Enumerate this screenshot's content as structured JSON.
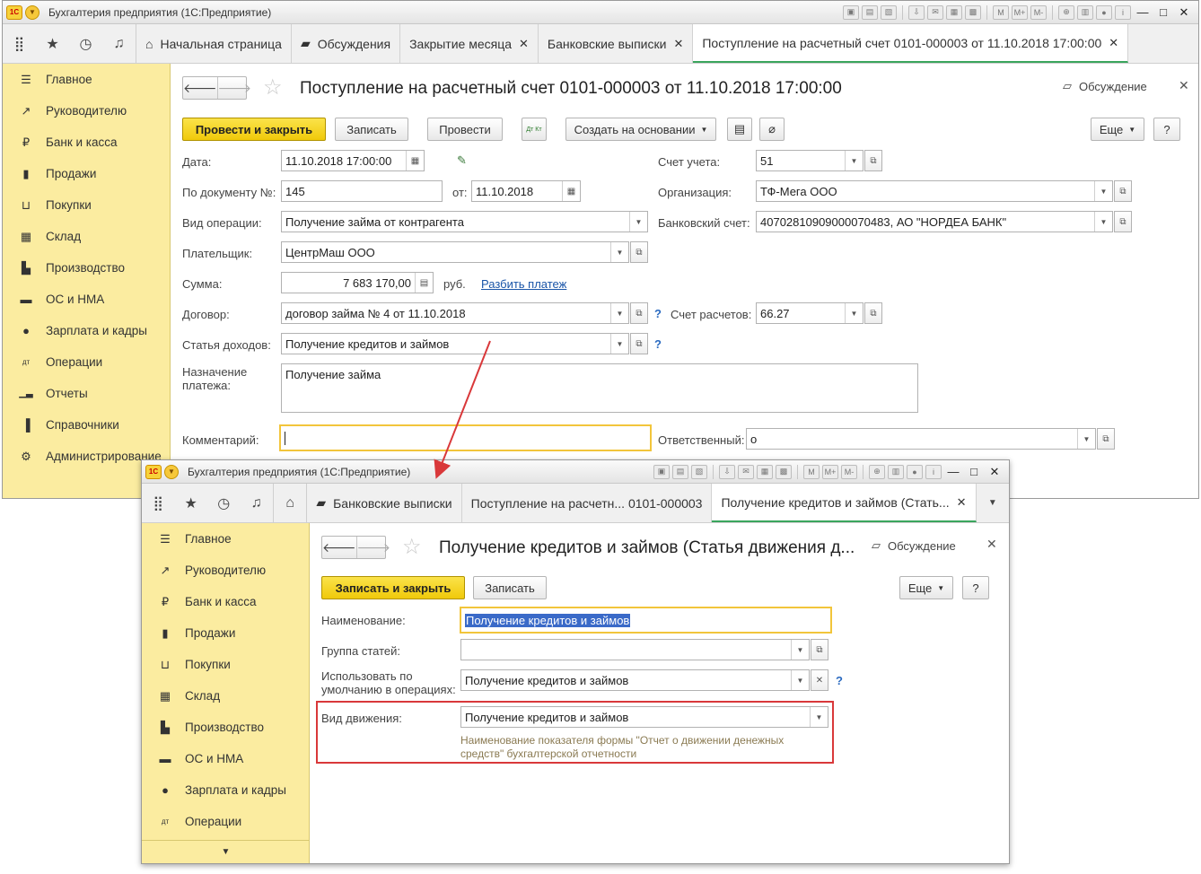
{
  "app_title": "Бухгалтерия предприятия  (1С:Предприятие)",
  "logo_text": "1С",
  "sidebar_items": [
    {
      "label": "Главное",
      "icon": "menu-icon",
      "glyph": "☰"
    },
    {
      "label": "Руководителю",
      "icon": "trend-icon",
      "glyph": "↗"
    },
    {
      "label": "Банк и касса",
      "icon": "ruble-icon",
      "glyph": "₽"
    },
    {
      "label": "Продажи",
      "icon": "bag-icon",
      "glyph": "▮"
    },
    {
      "label": "Покупки",
      "icon": "cart-icon",
      "glyph": "⊔"
    },
    {
      "label": "Склад",
      "icon": "warehouse-icon",
      "glyph": "▦"
    },
    {
      "label": "Производство",
      "icon": "factory-icon",
      "glyph": "▙"
    },
    {
      "label": "ОС и НМА",
      "icon": "truck-icon",
      "glyph": "▬"
    },
    {
      "label": "Зарплата и кадры",
      "icon": "person-icon",
      "glyph": "●"
    },
    {
      "label": "Операции",
      "icon": "dtkt-icon",
      "glyph": "дт"
    },
    {
      "label": "Отчеты",
      "icon": "barchart-icon",
      "glyph": "▁▃"
    },
    {
      "label": "Справочники",
      "icon": "book-icon",
      "glyph": "▐"
    },
    {
      "label": "Администрирование",
      "icon": "gear-icon",
      "glyph": "⚙"
    }
  ],
  "w1": {
    "tabs": [
      {
        "label": "Начальная страница",
        "icon": "home-icon"
      },
      {
        "label": "Обсуждения",
        "icon": "chat-icon"
      },
      {
        "label": "Закрытие месяца",
        "closable": true
      },
      {
        "label": "Банковские выписки",
        "closable": true
      },
      {
        "label": "Поступление на расчетный счет 0101-000003 от 11.10.2018 17:00:00",
        "closable": true,
        "active": true
      }
    ],
    "form_title": "Поступление на расчетный счет 0101-000003 от 11.10.2018 17:00:00",
    "discuss_label": "Обсуждение",
    "buttons": {
      "post_close": "Провести и закрыть",
      "save": "Записать",
      "post": "Провести",
      "dtkt": "Дт Кт",
      "create_based": "Создать на основании",
      "more": "Еще",
      "help": "?"
    },
    "labels": {
      "date": "Дата:",
      "doc_no": "По документу №:",
      "from": "от:",
      "op_type": "Вид операции:",
      "payer": "Плательщик:",
      "amount": "Сумма:",
      "currency": "руб.",
      "split": "Разбить платеж",
      "contract": "Договор:",
      "income_item": "Статья доходов:",
      "purpose": "Назначение платежа:",
      "comment": "Комментарий:",
      "account": "Счет учета:",
      "org": "Организация:",
      "bank_acc": "Банковский счет:",
      "settle_acc": "Счет расчетов:",
      "responsible": "Ответственный:",
      "question": "?"
    },
    "values": {
      "date": "11.10.2018 17:00:00",
      "doc_no": "145",
      "doc_date": "11.10.2018",
      "op_type": "Получение займа от контрагента",
      "payer": "ЦентрМаш ООО",
      "amount": "7 683 170,00",
      "contract": "договор займа № 4 от 11.10.2018",
      "income_item": "Получение кредитов и займов",
      "purpose": "Получение займа",
      "comment": "",
      "account": "51",
      "org": "ТФ-Мега ООО",
      "bank_acc": "40702810909000070483, АО \"НОРДЕА БАНК\"",
      "settle_acc": "66.27",
      "responsible": "о"
    }
  },
  "w2": {
    "tabs": [
      {
        "label": "Банковские выписки",
        "icon": "chat-icon",
        "closable": true
      },
      {
        "label": "Поступление на расчетн...  0101-000003",
        "closable": true
      },
      {
        "label": "Получение кредитов и займов (Стать...",
        "closable": true,
        "active": true
      }
    ],
    "form_title": "Получение кредитов и займов (Статья движения д...",
    "discuss_label": "Обсуждение",
    "buttons": {
      "save_close": "Записать и закрыть",
      "save": "Записать",
      "more": "Еще",
      "help": "?"
    },
    "labels": {
      "name": "Наименование:",
      "group": "Группа статей:",
      "default_use": "Использовать по умолчанию в операциях:",
      "movement": "Вид движения:",
      "question": "?"
    },
    "values": {
      "name": "Получение кредитов и займов",
      "group": "",
      "default_use": "Получение кредитов и займов",
      "movement": "Получение кредитов и займов"
    },
    "hint": "Наименование показателя формы \"Отчет о движении денежных средств\" бухгалтерской отчетности"
  },
  "colors": {
    "accent_yellow": "#f0c90a",
    "sidebar": "#fbeca0",
    "highlight_red": "#d9383a",
    "active_tab": "#3aa55d"
  }
}
